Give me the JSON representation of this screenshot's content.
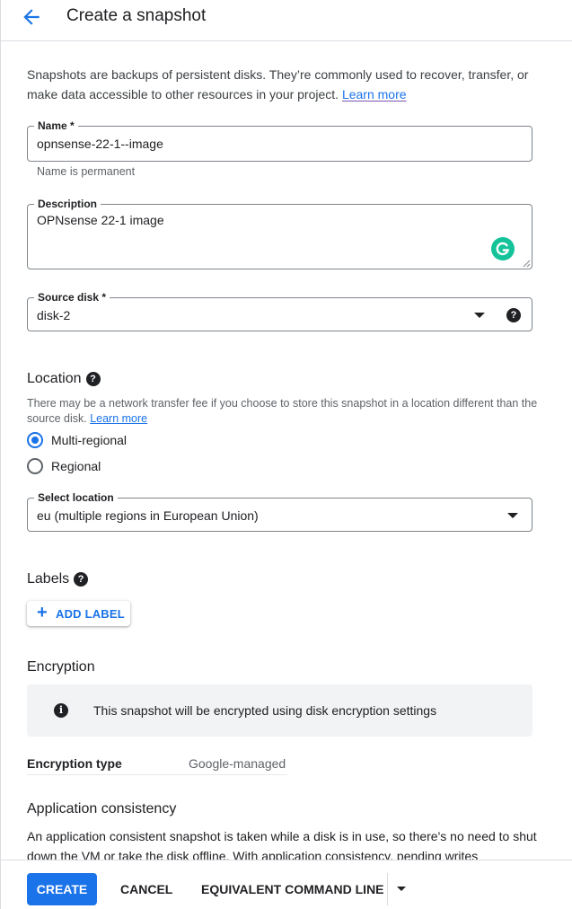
{
  "header": {
    "title": "Create a snapshot"
  },
  "intro": {
    "text": "Snapshots are backups of persistent disks. They’re commonly used to recover, transfer, or make data accessible to other resources in your project.",
    "link": "Learn more"
  },
  "name_field": {
    "label": "Name *",
    "value": "opnsense-22-1--image",
    "hint": "Name is permanent"
  },
  "description_field": {
    "label": "Description",
    "value": "OPNsense 22-1 image"
  },
  "source_disk": {
    "label": "Source disk *",
    "value": "disk-2",
    "help": "?"
  },
  "location": {
    "title": "Location",
    "help": "?",
    "description": "There may be a network transfer fee if you choose to store this snapshot in a location different than the source disk.",
    "link": "Learn more",
    "options": [
      {
        "label": "Multi-regional",
        "checked": true
      },
      {
        "label": "Regional",
        "checked": false
      }
    ],
    "select": {
      "label": "Select location",
      "value": "eu (multiple regions in European Union)"
    }
  },
  "labels": {
    "title": "Labels",
    "help": "?",
    "add_button": "ADD LABEL"
  },
  "encryption": {
    "title": "Encryption",
    "info_icon": "i",
    "notice": "This snapshot will be encrypted using disk encryption settings",
    "type_label": "Encryption type",
    "type_value": "Google-managed"
  },
  "consistency": {
    "title": "Application consistency",
    "text": "An application consistent snapshot is taken while a disk is in use, so there's no need to shut down the VM or take the disk offline. With application consistency, pending writes"
  },
  "footer": {
    "create": "CREATE",
    "cancel": "CANCEL",
    "command_line": "EQUIVALENT COMMAND LINE"
  },
  "colors": {
    "accent": "#1a73e8",
    "grammarly": "#15c39a"
  }
}
